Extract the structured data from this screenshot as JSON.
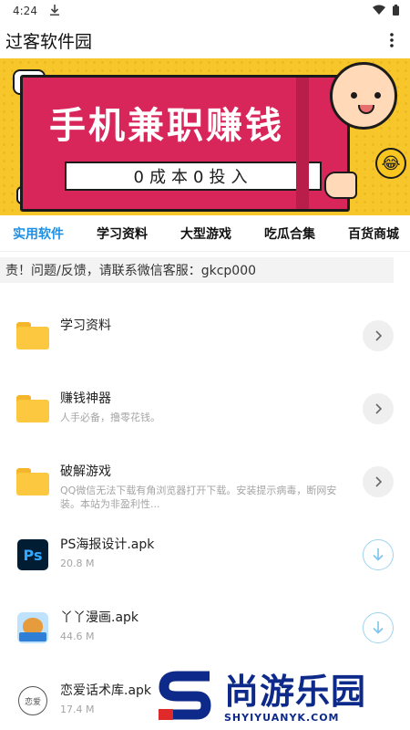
{
  "status_bar": {
    "time": "4:24",
    "icons": [
      "download-icon",
      "wifi-icon",
      "battery-icon"
    ]
  },
  "app_bar": {
    "title": "过客软件园",
    "menu_icon": "more-vert-icon"
  },
  "banner": {
    "title": "手机兼职赚钱",
    "subtitle": "0成本0投入",
    "chat_text": "•••"
  },
  "tabs": [
    {
      "label": "实用软件",
      "active": true
    },
    {
      "label": "学习资料",
      "active": false
    },
    {
      "label": "大型游戏",
      "active": false
    },
    {
      "label": "吃瓜合集",
      "active": false
    },
    {
      "label": "百货商城",
      "active": false
    }
  ],
  "notice": "责！问题/反馈，请联系微信客服：gkcp000",
  "items": [
    {
      "title": "学习资料",
      "desc": "",
      "icon": "folder-icon",
      "action": "chevron-right-icon"
    },
    {
      "title": "赚钱神器",
      "desc": "人手必备，撸零花钱。",
      "icon": "folder-icon",
      "action": "chevron-right-icon"
    },
    {
      "title": "破解游戏",
      "desc": "QQ微信无法下载有角浏览器打开下载。安装提示病毒，断网安装。本站为非盈利性...",
      "icon": "folder-icon",
      "action": "chevron-right-icon"
    },
    {
      "title": "PS海报设计.apk",
      "desc": "20.8 M",
      "icon": "photoshop-icon",
      "icon_text": "Ps",
      "action": "download-icon"
    },
    {
      "title": "丫丫漫画.apk",
      "desc": "44.6 M",
      "icon": "manga-app-icon",
      "action": "download-icon"
    },
    {
      "title": "恋爱话术库.apk",
      "desc": "17.4 M",
      "icon": "love-app-icon",
      "icon_text": "恋爱",
      "action": "download-icon"
    }
  ],
  "watermark": {
    "name": "尚游乐园",
    "url": "SHYIYUANYK.COM"
  },
  "colors": {
    "accent": "#1f8fe5",
    "banner_bg": "#f6c62a",
    "banner_card": "#d8265a",
    "folder": "#fcc83f",
    "watermark": "#0d2a8a"
  }
}
